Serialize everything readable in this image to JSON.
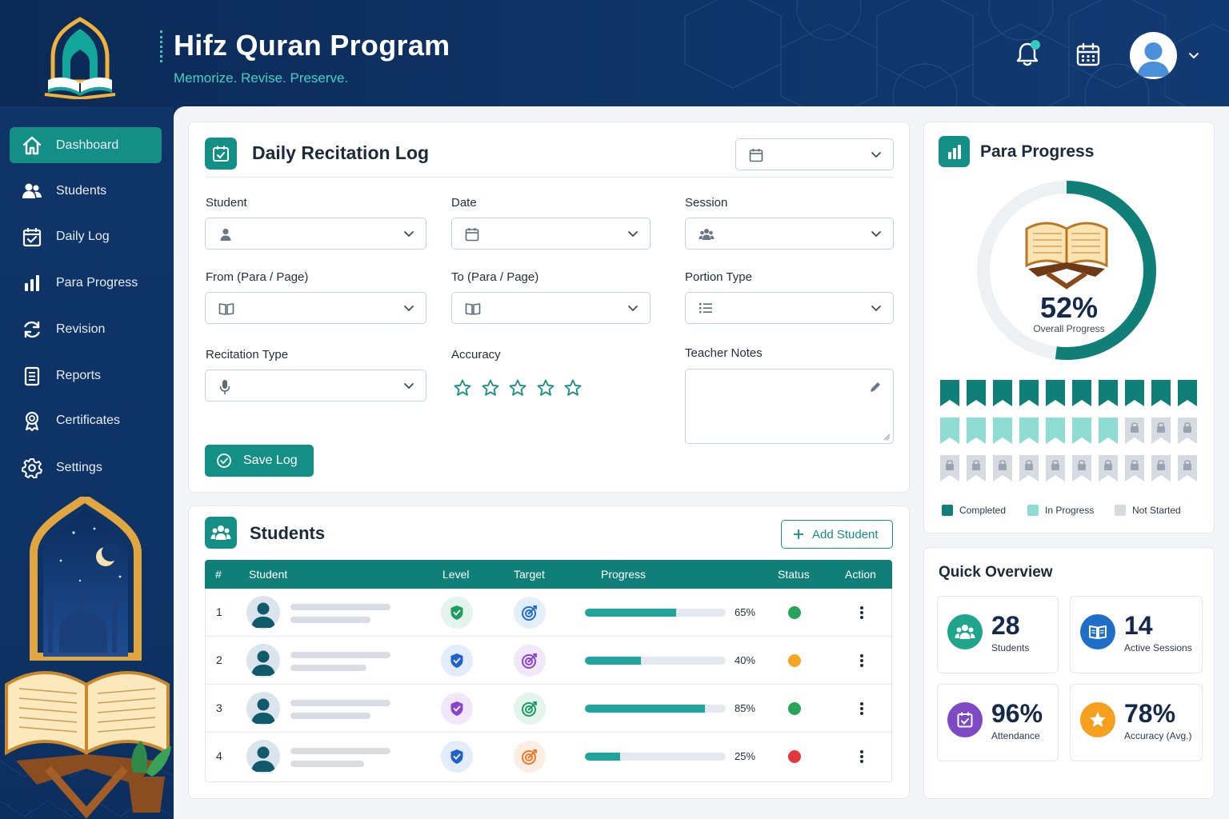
{
  "header": {
    "title": "Hifz Quran Program",
    "subtitle": "Memorize. Revise. Preserve."
  },
  "sidebar": {
    "items": [
      {
        "label": "Dashboard",
        "icon": "home-icon",
        "active": true
      },
      {
        "label": "Students",
        "icon": "users-icon"
      },
      {
        "label": "Daily Log",
        "icon": "calendar-check-icon"
      },
      {
        "label": "Para Progress",
        "icon": "bar-chart-icon"
      },
      {
        "label": "Revision",
        "icon": "refresh-icon"
      },
      {
        "label": "Reports",
        "icon": "document-icon"
      },
      {
        "label": "Certificates",
        "icon": "award-icon"
      },
      {
        "label": "Settings",
        "icon": "gear-icon"
      }
    ]
  },
  "log": {
    "title": "Daily Recitation Log",
    "fields": {
      "student": "Student",
      "date": "Date",
      "session": "Session",
      "from": "From (Para / Page)",
      "to": "To (Para / Page)",
      "portion_type": "Portion Type",
      "recitation_type": "Recitation Type",
      "accuracy": "Accuracy",
      "teacher_notes": "Teacher Notes"
    },
    "accuracy_stars": 0,
    "save_label": "Save Log"
  },
  "students": {
    "title": "Students",
    "add_label": "Add Student",
    "columns": {
      "num": "#",
      "student": "Student",
      "level": "Level",
      "target": "Target",
      "progress": "Progress",
      "status": "Status",
      "action": "Action"
    },
    "rows": [
      {
        "num": "1",
        "progress": 65,
        "progress_label": "65%",
        "status_color": "#27a35a",
        "level_color": "#1f9d63",
        "level_bg": "#e3f4ec",
        "target_color": "#1f6fc9",
        "target_bg": "#e3eefb"
      },
      {
        "num": "2",
        "progress": 40,
        "progress_label": "40%",
        "status_color": "#f5a623",
        "level_color": "#1f63c9",
        "level_bg": "#e3ecfb",
        "target_color": "#8a45c9",
        "target_bg": "#f1e7fa"
      },
      {
        "num": "3",
        "progress": 85,
        "progress_label": "85%",
        "status_color": "#27a35a",
        "level_color": "#8a45c9",
        "level_bg": "#f1e7fa",
        "target_color": "#1f9d63",
        "target_bg": "#e3f4ec"
      },
      {
        "num": "4",
        "progress": 25,
        "progress_label": "25%",
        "status_color": "#e0383e",
        "level_color": "#1f63c9",
        "level_bg": "#e3ecfb",
        "target_color": "#f2792b",
        "target_bg": "#fdeee3"
      }
    ]
  },
  "para": {
    "title": "Para Progress",
    "overall": 52,
    "overall_label": "52%",
    "overall_caption": "Overall Progress",
    "completed": 10,
    "in_progress": 7,
    "not_started": 13,
    "legend": {
      "completed": "Completed",
      "in_progress": "In Progress",
      "not_started": "Not Started"
    },
    "colors": {
      "completed": "#0f7f78",
      "in_progress": "#8fdcd2",
      "not_started": "#d6dbe1"
    }
  },
  "overview": {
    "title": "Quick Overview",
    "stats": [
      {
        "value": "28",
        "label": "Students",
        "color": "#1ea58c"
      },
      {
        "value": "14",
        "label": "Active Sessions",
        "color": "#1f6fc9"
      },
      {
        "value": "96%",
        "label": "Attendance",
        "color": "#7d4ac4"
      },
      {
        "value": "78%",
        "label": "Accuracy (Avg.)",
        "color": "#f5a01f"
      }
    ]
  }
}
